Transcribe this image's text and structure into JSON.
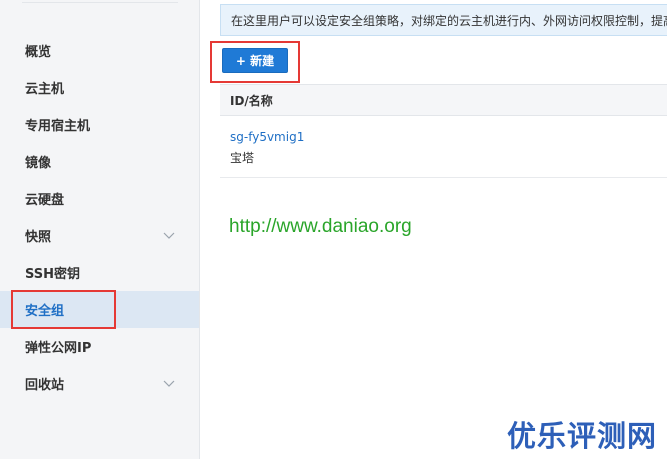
{
  "sidebar": {
    "items": [
      {
        "label": "概览"
      },
      {
        "label": "云主机"
      },
      {
        "label": "专用宿主机"
      },
      {
        "label": "镜像"
      },
      {
        "label": "云硬盘"
      },
      {
        "label": "快照",
        "icon": "chevron-down-icon"
      },
      {
        "label": "SSH密钥"
      },
      {
        "label": "安全组",
        "active": true
      },
      {
        "label": "弹性公网IP"
      },
      {
        "label": "回收站",
        "icon": "chevron-down-icon"
      }
    ]
  },
  "main": {
    "notice": "在这里用户可以设定安全组策略，对绑定的云主机进行内、外网访问权限控制，提高",
    "new_button_label": "+ 新建",
    "table": {
      "header": "ID/名称",
      "rows": [
        {
          "id": "sg-fy5vmig1",
          "name": "宝塔"
        }
      ]
    }
  },
  "watermarks": {
    "url": "http://www.daniao.org",
    "brand": "优乐评测网"
  },
  "colors": {
    "accent": "#1f7ad6",
    "highlight_box": "#e53935",
    "link": "#1f6fc5",
    "watermark_url": "#2aa52a",
    "watermark_brand": "#2d5fb8"
  }
}
